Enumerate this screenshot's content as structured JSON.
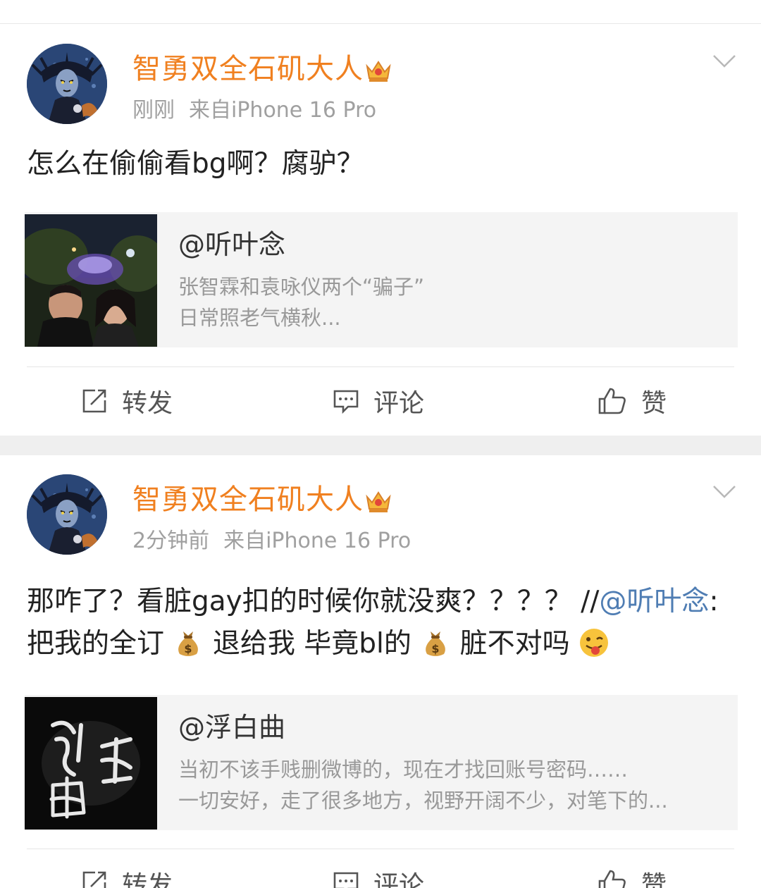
{
  "posts": [
    {
      "username": "智勇双全石矶大人",
      "time": "刚刚",
      "source": "来自iPhone 16 Pro",
      "text": "怎么在偷偷看bg啊？腐驴？",
      "card": {
        "title": "@听叶念",
        "line1": "张智霖和袁咏仪两个“骗子”",
        "line2": "日常照老气横秋..."
      }
    },
    {
      "username": "智勇双全石矶大人",
      "time": "2分钟前",
      "source": "来自iPhone 16 Pro",
      "text_parts": {
        "p1": "那咋了？看脏gay扣的时候你就没爽？？？？ //",
        "mention": "@听叶念",
        "p2": ":把我的全订",
        "p3": "退给我 毕竟bl的",
        "p4": "脏不对吗"
      },
      "card": {
        "title": "@浮白曲",
        "line1": "当初不该手贱删微博的，现在才找回账号密码……",
        "line2": "一切安好，走了很多地方，视野开阔不少，对笔下的..."
      }
    }
  ],
  "actions": {
    "repost": "转发",
    "comment": "评论",
    "like": "赞"
  },
  "colors": {
    "username": "#f08020",
    "mention": "#4f7db3",
    "meta": "#a0a0a0",
    "card_bg": "#f4f4f4"
  },
  "icons": [
    "crown-icon",
    "chevron-down-icon",
    "repost-icon",
    "comment-icon",
    "like-icon",
    "money-bag-icon",
    "winking-tongue-emoji"
  ]
}
